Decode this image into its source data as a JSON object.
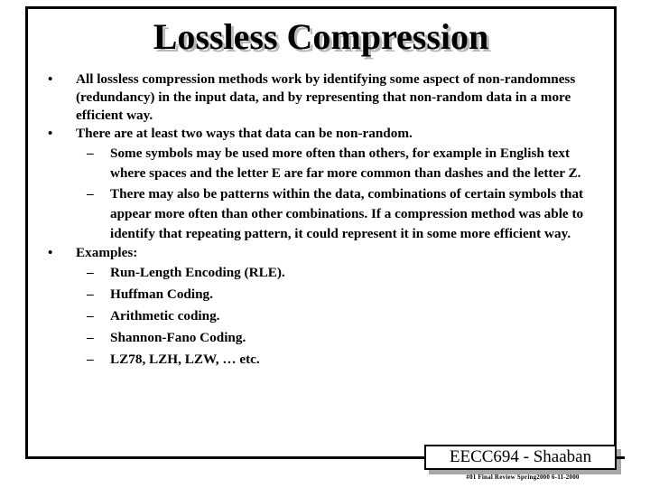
{
  "slide": {
    "title": "Lossless Compression",
    "bullets": [
      {
        "level": 1,
        "marker": "•",
        "text": "All lossless compression methods work by identifying some aspect of non-randomness (redundancy) in the input data, and by representing that non-random data in a more efficient way."
      },
      {
        "level": 1,
        "marker": "•",
        "text": "There are at least two ways that data can be non-random."
      },
      {
        "level": 2,
        "marker": "–",
        "text": "Some symbols may be used more often than others, for example in English text where spaces and the letter E are far more common than dashes and the letter Z."
      },
      {
        "level": 2,
        "marker": "–",
        "text": "There may also be patterns within the data, combinations of certain symbols that appear more often than other combinations.  If a compression method was able to identify that repeating pattern, it could represent it in some more efficient way."
      }
    ],
    "examples_heading": {
      "marker": "•",
      "text": "Examples:"
    },
    "examples": [
      {
        "marker": "–",
        "text": "Run-Length Encoding (RLE)."
      },
      {
        "marker": "–",
        "text": "Huffman Coding."
      },
      {
        "marker": "–",
        "text": "Arithmetic coding."
      },
      {
        "marker": "–",
        "text": "Shannon-Fano Coding."
      },
      {
        "marker": "–",
        "text": "LZ78, LZH, LZW, … etc."
      }
    ],
    "footer": {
      "badge": "EECC694 - Shaaban",
      "subtext": "#01  Final Review   Spring2000   6-11-2000"
    },
    "colors": {
      "text": "#000000",
      "background": "#ffffff",
      "title_shadow": "#b9b9b9",
      "badge_shadow": "#a8a8a8"
    }
  }
}
